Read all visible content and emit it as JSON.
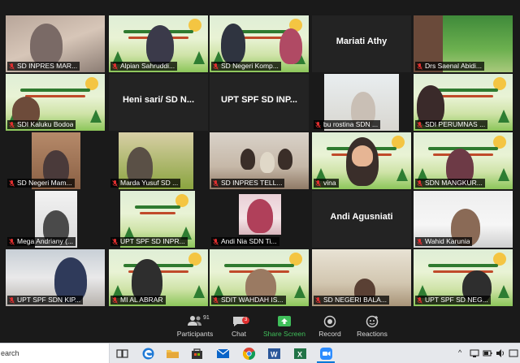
{
  "tiles": [
    {
      "caption": "SD INPRES MAR...",
      "muted": true
    },
    {
      "caption": "Alpian Sahruddi...",
      "muted": true
    },
    {
      "caption": "SD Negeri Komp...",
      "muted": true
    },
    {
      "caption": "",
      "name_only": "Mariati Athy",
      "muted": true
    },
    {
      "caption": "Drs Saenal Abidi...",
      "muted": true
    },
    {
      "caption": "SDI Kaluku Bodoa",
      "muted": true
    },
    {
      "caption": "",
      "name_only": "Heni sari/ SD N...",
      "muted": true
    },
    {
      "caption": "",
      "name_only": "UPT SPF SD INP...",
      "muted": true
    },
    {
      "caption": "bu rostina SDN ...",
      "muted": true
    },
    {
      "caption": "SDI PERUMNAS ...",
      "muted": true
    },
    {
      "caption": "SD Negeri Mam...",
      "muted": true
    },
    {
      "caption": "Marda Yusuf SD ...",
      "muted": true
    },
    {
      "caption": "SD INPRES TELL...",
      "muted": true
    },
    {
      "caption": "vina",
      "muted": true
    },
    {
      "caption": "SDN MANGKUR...",
      "muted": true
    },
    {
      "caption": "Mega Andriany (...",
      "muted": true
    },
    {
      "caption": "UPT SPF SD INPR...",
      "muted": true
    },
    {
      "caption": "Andi Nia SDN Ti...",
      "muted": true
    },
    {
      "caption": "",
      "name_only": "Andi Agusniati",
      "muted": true
    },
    {
      "caption": "Wahid Karunia",
      "muted": true,
      "active": true
    },
    {
      "caption": "UPT SPF SDN KIP...",
      "muted": true
    },
    {
      "caption": "MI AL ABRAR",
      "muted": true
    },
    {
      "caption": "SDIT WAHDAH IS...",
      "muted": true
    },
    {
      "caption": "SD NEGERI BALA...",
      "muted": true
    },
    {
      "caption": "UPT SPF SD NEG...",
      "muted": true
    }
  ],
  "toolbar": {
    "participants_label": "Participants",
    "participants_count": "91",
    "chat_label": "Chat",
    "chat_badge": "3",
    "share_label": "Share Screen",
    "record_label": "Record",
    "reactions_label": "Reactions"
  },
  "taskbar": {
    "search_text": "earch",
    "tray_arrow": "^",
    "accent": "#0078d7"
  },
  "colors": {
    "share_green": "#3fbf5a",
    "muted_red": "#e02f2f",
    "active_border": "#f0f060"
  }
}
